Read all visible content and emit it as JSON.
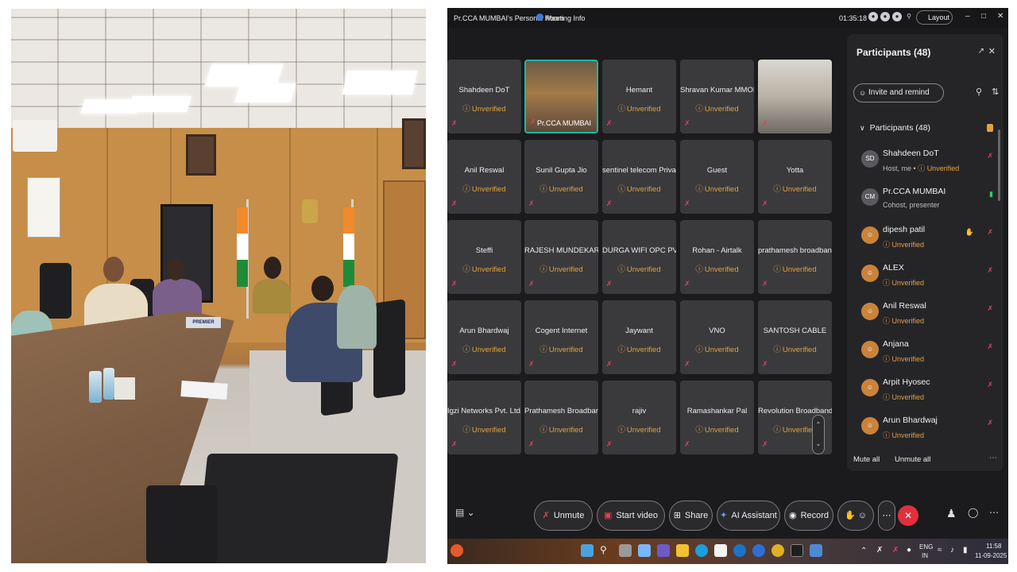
{
  "meeting": {
    "room_title": "Pr.CCA MUMBAI's Personal Room",
    "meeting_info": "Meeting Info",
    "timer": "01:35:18",
    "layout_label": "Layout"
  },
  "tiles": [
    {
      "name": "Shahdeen DoT",
      "status": "Unverified"
    },
    {
      "name": "Pr.CCA MUMBAI",
      "status": ""
    },
    {
      "name": "Hemant",
      "status": "Unverified"
    },
    {
      "name": "Shravan Kumar MMOPL",
      "status": "Unverified"
    },
    {
      "name": "",
      "status": ""
    },
    {
      "name": "Anil Reswal",
      "status": "Unverified"
    },
    {
      "name": "Sunil Gupta Jio",
      "status": "Unverified"
    },
    {
      "name": "sentinel telecom Priva...",
      "status": "Unverified"
    },
    {
      "name": "Guest",
      "status": "Unverified"
    },
    {
      "name": "Yotta",
      "status": "Unverified"
    },
    {
      "name": "Steffi",
      "status": "Unverified"
    },
    {
      "name": "RAJESH MUNDEKAR",
      "status": "Unverified"
    },
    {
      "name": "DURGA WIFI OPC PVT...",
      "status": "Unverified"
    },
    {
      "name": "Rohan - Airtalk",
      "status": "Unverified"
    },
    {
      "name": "prathamesh broadban...",
      "status": "Unverified"
    },
    {
      "name": "Arun Bhardwaj",
      "status": "Unverified"
    },
    {
      "name": "Cogent Internet",
      "status": "Unverified"
    },
    {
      "name": "Jaywant",
      "status": "Unverified"
    },
    {
      "name": "VNO",
      "status": "Unverified"
    },
    {
      "name": "SANTOSH CABLE",
      "status": "Unverified"
    },
    {
      "name": "Igzi Networks Pvt. Ltd.",
      "status": "Unverified"
    },
    {
      "name": "Prathamesh Broadband",
      "status": "Unverified"
    },
    {
      "name": "rajiv",
      "status": "Unverified"
    },
    {
      "name": "Ramashankar Pal",
      "status": "Unverified"
    },
    {
      "name": "Revolution Broadband...",
      "status": "Unverified"
    }
  ],
  "participants_panel": {
    "title": "Participants (48)",
    "invite_label": "Invite and remind",
    "section_label": "Participants (48)",
    "mute_all": "Mute all",
    "unmute_all": "Unmute all",
    "list": [
      {
        "initials": "SD",
        "name": "Shahdeen DoT",
        "sub": "Host, me • ",
        "status": "Unverified"
      },
      {
        "initials": "CM",
        "name": "Pr.CCA MUMBAI",
        "sub": "Cohost, presenter",
        "status": ""
      },
      {
        "initials": "",
        "name": "dipesh patil",
        "sub": "",
        "status": "Unverified"
      },
      {
        "initials": "",
        "name": "ALEX",
        "sub": "",
        "status": "Unverified"
      },
      {
        "initials": "",
        "name": "Anil Reswal",
        "sub": "",
        "status": "Unverified"
      },
      {
        "initials": "",
        "name": "Anjana",
        "sub": "",
        "status": "Unverified"
      },
      {
        "initials": "",
        "name": "Arpit Hyosec",
        "sub": "",
        "status": "Unverified"
      },
      {
        "initials": "",
        "name": "Arun Bhardwaj",
        "sub": "",
        "status": "Unverified"
      }
    ]
  },
  "controls": {
    "unmute": "Unmute",
    "start_video": "Start video",
    "share": "Share",
    "ai_assistant": "AI Assistant",
    "record": "Record"
  },
  "taskbar": {
    "lang_top": "ENG",
    "lang_bottom": "IN",
    "time": "11:58",
    "date": "11-09-2025"
  },
  "photo": {
    "nameplate": "PREMIER"
  },
  "colors": {
    "unverified": "#e2a13c",
    "muted_mic": "#e0405a",
    "leave": "#e0303e",
    "active_speaker": "#1fb6a0"
  }
}
